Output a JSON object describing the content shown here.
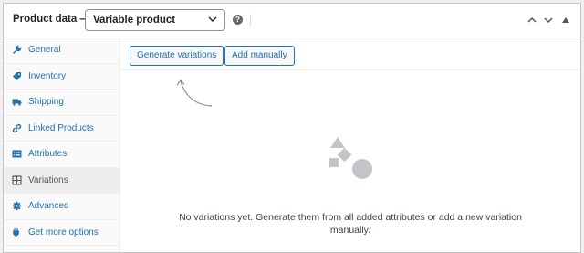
{
  "header": {
    "title": "Product data —",
    "product_type": {
      "selected": "Variable product"
    },
    "help_icon": "help-icon",
    "controls": [
      "move-up-icon",
      "move-down-icon",
      "toggle-panel-icon"
    ]
  },
  "sidebar": {
    "tabs": [
      {
        "label": "General",
        "icon": "wrench-icon",
        "active": false
      },
      {
        "label": "Inventory",
        "icon": "tag-icon",
        "active": false
      },
      {
        "label": "Shipping",
        "icon": "truck-icon",
        "active": false
      },
      {
        "label": "Linked Products",
        "icon": "link-icon",
        "active": false
      },
      {
        "label": "Attributes",
        "icon": "list-icon",
        "active": false
      },
      {
        "label": "Variations",
        "icon": "grid-icon",
        "active": true
      },
      {
        "label": "Advanced",
        "icon": "gear-icon",
        "active": false
      },
      {
        "label": "Get more options",
        "icon": "plugin-icon",
        "active": false
      }
    ]
  },
  "main": {
    "generate_label": "Generate variations",
    "add_manual_label": "Add manually",
    "empty_state_text": "No variations yet. Generate them from all added attributes or add a new variation manually."
  },
  "colors": {
    "link": "#2271b1",
    "border": "#c3c4c7",
    "active_tab_bg": "#eeeeee",
    "icon_gray": "#c3c4c7"
  }
}
